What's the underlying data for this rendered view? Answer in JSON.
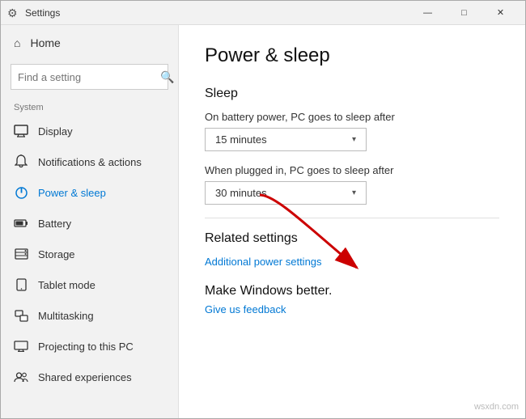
{
  "window": {
    "title": "Settings",
    "controls": {
      "minimize": "—",
      "maximize": "□",
      "close": "✕"
    }
  },
  "sidebar": {
    "home_label": "Home",
    "search_placeholder": "Find a setting",
    "section_label": "System",
    "items": [
      {
        "id": "display",
        "label": "Display",
        "icon": "monitor"
      },
      {
        "id": "notifications",
        "label": "Notifications & actions",
        "icon": "bell"
      },
      {
        "id": "power",
        "label": "Power & sleep",
        "icon": "power",
        "active": true
      },
      {
        "id": "battery",
        "label": "Battery",
        "icon": "battery"
      },
      {
        "id": "storage",
        "label": "Storage",
        "icon": "storage"
      },
      {
        "id": "tablet",
        "label": "Tablet mode",
        "icon": "tablet"
      },
      {
        "id": "multitasking",
        "label": "Multitasking",
        "icon": "multitask"
      },
      {
        "id": "projecting",
        "label": "Projecting to this PC",
        "icon": "project"
      },
      {
        "id": "shared",
        "label": "Shared experiences",
        "icon": "shared"
      }
    ]
  },
  "main": {
    "page_title": "Power & sleep",
    "sleep_section": {
      "title": "Sleep",
      "battery_label": "On battery power, PC goes to sleep after",
      "battery_value": "15 minutes",
      "plugged_label": "When plugged in, PC goes to sleep after",
      "plugged_value": "30 minutes"
    },
    "related_section": {
      "title": "Related settings",
      "link": "Additional power settings"
    },
    "make_windows": {
      "title": "Make Windows better.",
      "link": "Give us feedback"
    }
  },
  "watermark": "wsxdn.com"
}
